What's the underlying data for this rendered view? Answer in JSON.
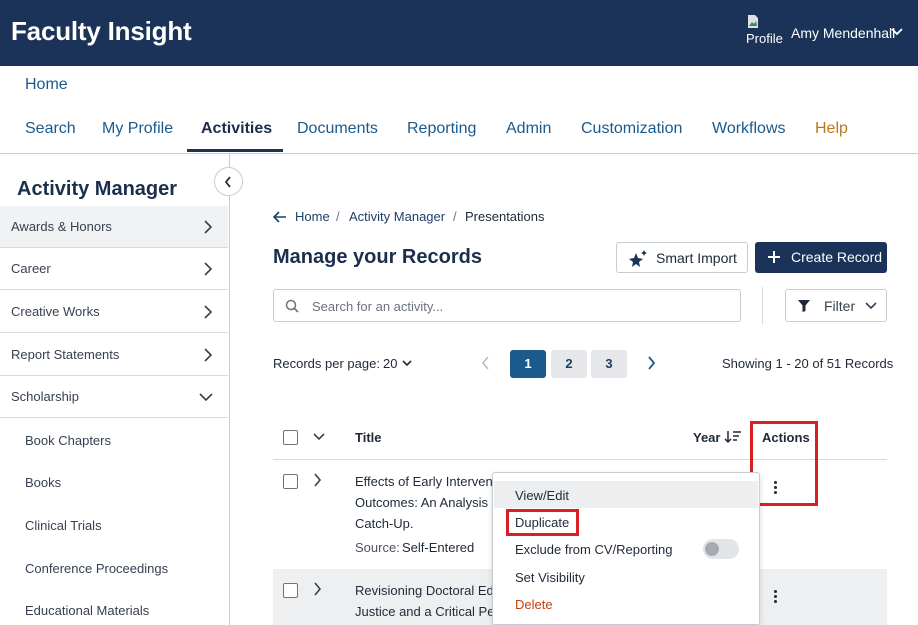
{
  "header": {
    "app_title": "Faculty Insight",
    "profile_alt": "Profile",
    "user_name": "Amy Mendenhall"
  },
  "nav": {
    "home": "Home",
    "tabs": [
      {
        "label": "Search"
      },
      {
        "label": "My Profile"
      },
      {
        "label": "Activities",
        "active": true
      },
      {
        "label": "Documents"
      },
      {
        "label": "Reporting"
      },
      {
        "label": "Admin"
      },
      {
        "label": "Customization"
      },
      {
        "label": "Workflows"
      },
      {
        "label": "Help"
      }
    ]
  },
  "sidebar": {
    "title": "Activity Manager",
    "items": [
      {
        "label": "Awards & Honors"
      },
      {
        "label": "Career"
      },
      {
        "label": "Creative Works"
      },
      {
        "label": "Report Statements"
      },
      {
        "label": "Scholarship",
        "expanded": true
      }
    ],
    "subitems": [
      "Book Chapters",
      "Books",
      "Clinical Trials",
      "Conference Proceedings",
      "Educational Materials"
    ]
  },
  "breadcrumb": {
    "home": "Home",
    "sep": "/",
    "parent": "Activity Manager",
    "current": "Presentations"
  },
  "main": {
    "title": "Manage your Records",
    "smart_import": "Smart Import",
    "create_record": "Create Record",
    "search_placeholder": "Search for an activity...",
    "filter": "Filter"
  },
  "pagination": {
    "records_per_page_label": "Records per page:",
    "records_per_page_value": "20",
    "pages": [
      "1",
      "2",
      "3"
    ],
    "current_page": "1",
    "showing": "Showing 1 - 20 of 51 Records"
  },
  "table": {
    "columns": {
      "title": "Title",
      "year": "Year",
      "actions": "Actions"
    },
    "rows": [
      {
        "title_lines": [
          "Effects of Early Interven",
          "Outcomes: An Analysis o",
          "Catch-Up."
        ],
        "source_label": "Source:",
        "source_value": "Self-Entered"
      },
      {
        "title_lines": [
          "Revisioning Doctoral Ed",
          "Justice and a Critical Pe"
        ]
      }
    ]
  },
  "menu": {
    "items": [
      "View/Edit",
      "Duplicate",
      "Exclude from CV/Reporting",
      "Set Visibility",
      "Delete"
    ],
    "exclude_toggle_on": false
  },
  "colors": {
    "header_bg": "#1b3358",
    "link": "#1b5a8c",
    "help": "#c0771b",
    "highlight_box": "#d71f26",
    "delete": "#c2410c"
  }
}
